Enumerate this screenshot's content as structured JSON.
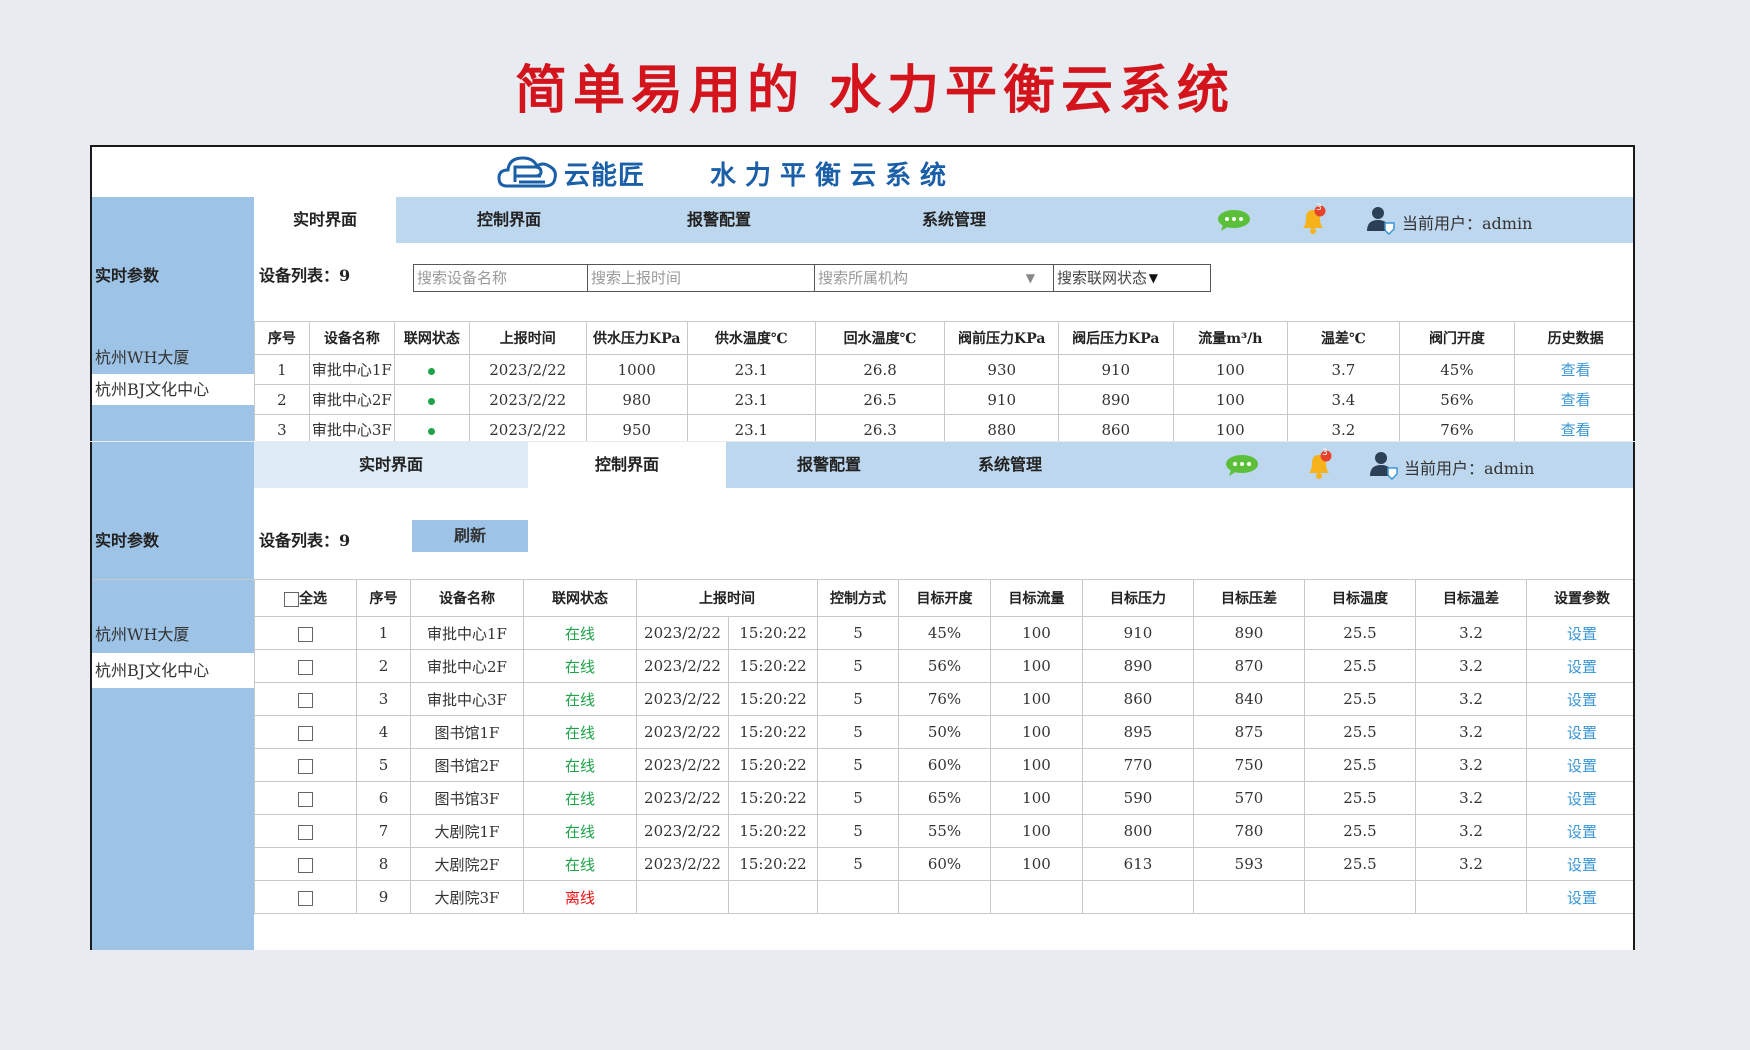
{
  "headline": "简单易用的 水力平衡云系统",
  "brand": {
    "name": "云能匠",
    "system_title": "水力平衡云系统"
  },
  "nav": {
    "tabs": [
      "实时界面",
      "控制界面",
      "报警配置",
      "系统管理"
    ],
    "notification_count": "3",
    "user_label": "当前用户：admin"
  },
  "sidebar": {
    "section_title": "实时参数",
    "sites": [
      "杭州WH大厦",
      "杭州BJ文化中心"
    ]
  },
  "realtime": {
    "device_count_label": "设备列表：9",
    "search": {
      "device_name": "搜索设备名称",
      "report_time": "搜索上报时间",
      "org": "搜索所属机构",
      "net_status": "搜索联网状态"
    },
    "headers": [
      "序号",
      "设备名称",
      "联网状态",
      "上报时间",
      "供水压力KPa",
      "供水温度℃",
      "回水温度℃",
      "阀前压力KPa",
      "阀后压力KPa",
      "流量m³/h",
      "温差℃",
      "阀门开度",
      "历史数据"
    ],
    "rows": [
      [
        "1",
        "审批中心1F",
        "",
        "2023/2/22",
        "1000",
        "23.1",
        "26.8",
        "930",
        "910",
        "100",
        "3.7",
        "45%",
        "查看"
      ],
      [
        "2",
        "审批中心2F",
        "",
        "2023/2/22",
        "980",
        "23.1",
        "26.5",
        "910",
        "890",
        "100",
        "3.4",
        "56%",
        "查看"
      ],
      [
        "3",
        "审批中心3F",
        "",
        "2023/2/22",
        "950",
        "23.1",
        "26.3",
        "880",
        "860",
        "100",
        "3.2",
        "76%",
        "查看"
      ]
    ],
    "online_color": "#1fa34a"
  },
  "control": {
    "device_count_label": "设备列表：9",
    "refresh_label": "刷新",
    "select_all_label": "全选",
    "headers": [
      "序号",
      "设备名称",
      "联网状态",
      "上报时间",
      "控制方式",
      "目标开度",
      "目标流量",
      "目标压力",
      "目标压差",
      "目标温度",
      "目标温差",
      "设置参数"
    ],
    "rows": [
      [
        "1",
        "审批中心1F",
        "在线",
        "2023/2/22",
        "15:20:22",
        "5",
        "45%",
        "100",
        "910",
        "890",
        "25.5",
        "3.2",
        "设置"
      ],
      [
        "2",
        "审批中心2F",
        "在线",
        "2023/2/22",
        "15:20:22",
        "5",
        "56%",
        "100",
        "890",
        "870",
        "25.5",
        "3.2",
        "设置"
      ],
      [
        "3",
        "审批中心3F",
        "在线",
        "2023/2/22",
        "15:20:22",
        "5",
        "76%",
        "100",
        "860",
        "840",
        "25.5",
        "3.2",
        "设置"
      ],
      [
        "4",
        "图书馆1F",
        "在线",
        "2023/2/22",
        "15:20:22",
        "5",
        "50%",
        "100",
        "895",
        "875",
        "25.5",
        "3.2",
        "设置"
      ],
      [
        "5",
        "图书馆2F",
        "在线",
        "2023/2/22",
        "15:20:22",
        "5",
        "60%",
        "100",
        "770",
        "750",
        "25.5",
        "3.2",
        "设置"
      ],
      [
        "6",
        "图书馆3F",
        "在线",
        "2023/2/22",
        "15:20:22",
        "5",
        "65%",
        "100",
        "590",
        "570",
        "25.5",
        "3.2",
        "设置"
      ],
      [
        "7",
        "大剧院1F",
        "在线",
        "2023/2/22",
        "15:20:22",
        "5",
        "55%",
        "100",
        "800",
        "780",
        "25.5",
        "3.2",
        "设置"
      ],
      [
        "8",
        "大剧院2F",
        "在线",
        "2023/2/22",
        "15:20:22",
        "5",
        "60%",
        "100",
        "613",
        "593",
        "25.5",
        "3.2",
        "设置"
      ],
      [
        "9",
        "大剧院3F",
        "离线",
        "",
        "",
        "",
        "",
        "",
        "",
        "",
        "",
        "",
        "设置"
      ]
    ],
    "offline_color": "#ee1111"
  }
}
